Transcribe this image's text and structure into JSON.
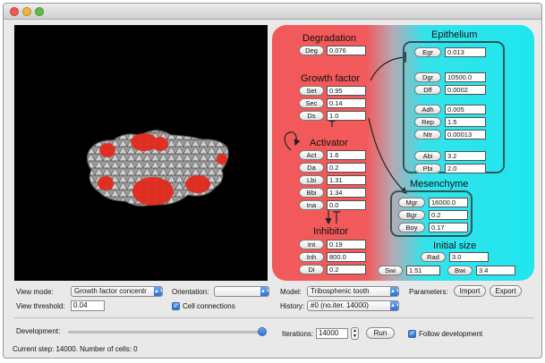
{
  "window": {
    "traffic_lights": {
      "close": "#ee5b52",
      "minimize": "#f0b43a",
      "zoom": "#5fbd46"
    }
  },
  "model_panel": {
    "colors": {
      "red_region": "#f2595a",
      "cyan_region": "#1fe6ee",
      "box_border": "#2e5757"
    },
    "degradation": {
      "title": "Degradation",
      "params": [
        {
          "name": "Deg",
          "value": "0.076"
        }
      ]
    },
    "growth_factor": {
      "title": "Growth factor",
      "params": [
        {
          "name": "Set",
          "value": "0.95"
        },
        {
          "name": "Sec",
          "value": "0.14"
        },
        {
          "name": "Ds",
          "value": "1.0"
        }
      ]
    },
    "activator": {
      "title": "Activator",
      "params": [
        {
          "name": "Act",
          "value": "1.6"
        },
        {
          "name": "Da",
          "value": "0.2"
        },
        {
          "name": "Lbi",
          "value": "1.31"
        },
        {
          "name": "Bbi",
          "value": "1.34"
        },
        {
          "name": "Ina",
          "value": "0.0"
        }
      ]
    },
    "inhibitor": {
      "title": "Inhibitor",
      "params": [
        {
          "name": "Int",
          "value": "0.19"
        },
        {
          "name": "Inh",
          "value": "800.0"
        },
        {
          "name": "Di",
          "value": "0.2"
        }
      ]
    },
    "epithelium": {
      "title": "Epithelium",
      "params": [
        {
          "name": "Egr",
          "value": "0.013"
        },
        {
          "name": "Dgr",
          "value": "10500.0"
        },
        {
          "name": "Dff",
          "value": "0.0002"
        },
        {
          "name": "Adh",
          "value": "0.005"
        },
        {
          "name": "Rep",
          "value": "1.5"
        },
        {
          "name": "Ntr",
          "value": "0.00013"
        },
        {
          "name": "Abi",
          "value": "3.2"
        },
        {
          "name": "Pbi",
          "value": "2.0"
        }
      ]
    },
    "mesenchyme": {
      "title": "Mesenchyme",
      "params": [
        {
          "name": "Mgr",
          "value": "16000.0"
        },
        {
          "name": "Bgr",
          "value": "0.2"
        },
        {
          "name": "Boy",
          "value": "0.17"
        }
      ]
    },
    "initial_size": {
      "title": "Initial size",
      "params": [
        {
          "name": "Rad",
          "value": "3.0"
        },
        {
          "name": "Swi",
          "value": "1.51"
        },
        {
          "name": "Bwi",
          "value": "3.4"
        }
      ]
    }
  },
  "controls": {
    "view_mode": {
      "label": "View mode:",
      "value": "Growth factor concentr"
    },
    "orientation": {
      "label": "Orientation:",
      "value": ""
    },
    "view_threshold": {
      "label": "View threshold:",
      "value": "0.04"
    },
    "cell_connections": {
      "label": "Cell connections",
      "checked": true
    },
    "model": {
      "label": "Model:",
      "value": "Tribosphenic tooth"
    },
    "history": {
      "label": "History:",
      "value": "#0 (no.iter. 14000)"
    },
    "parameters": {
      "label": "Parameters:",
      "import": "Import",
      "export": "Export"
    },
    "development": {
      "label": "Development:",
      "progress": 1.0
    },
    "iterations": {
      "label": "Iterations:",
      "value": "14000"
    },
    "run": "Run",
    "follow_development": {
      "label": "Follow development",
      "checked": true
    }
  },
  "status": "Current step: 14000. Number of cells: 0"
}
